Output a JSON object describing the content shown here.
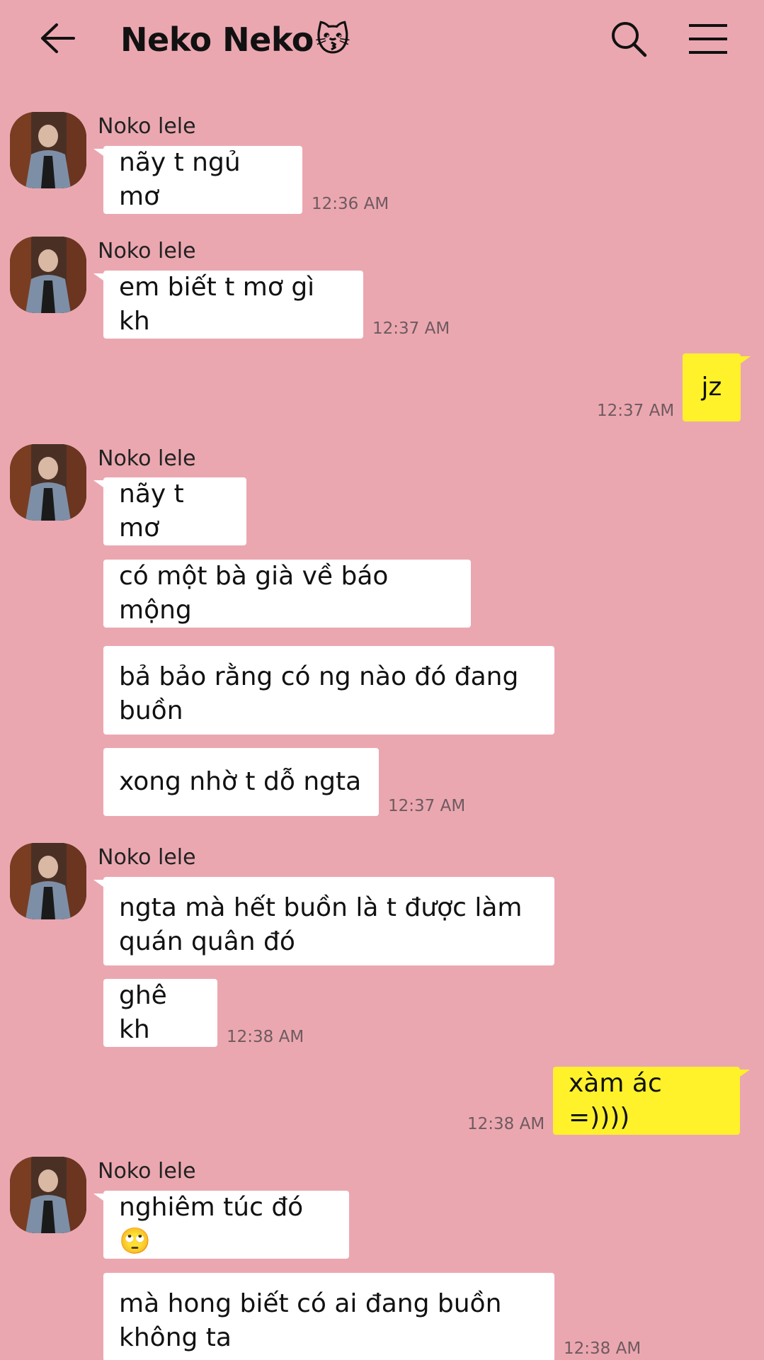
{
  "header": {
    "title": "Neko Neko",
    "title_emoji": "😽",
    "back_icon": "arrow-left-icon",
    "search_icon": "search-icon",
    "menu_icon": "hamburger-menu-icon"
  },
  "colors": {
    "background": "#eba7b0",
    "incoming_bubble": "#ffffff",
    "outgoing_bubble": "#fff22a"
  },
  "messages": [
    {
      "sender": "Noko lele",
      "text": "nãy t ngủ mơ",
      "time": "12:36 AM"
    },
    {
      "sender": "Noko lele",
      "text": "em biết t mơ gì kh",
      "time": "12:37 AM"
    },
    {
      "sender": "me",
      "text": "jz",
      "time": "12:37 AM"
    },
    {
      "sender": "Noko lele",
      "text": "nãy t mơ"
    },
    {
      "sender": "Noko lele",
      "text": "có một bà già về báo mộng"
    },
    {
      "sender": "Noko lele",
      "text": "bả bảo rằng có ng nào đó đang buồn"
    },
    {
      "sender": "Noko lele",
      "text": "xong nhờ t dỗ ngta",
      "time": "12:37 AM"
    },
    {
      "sender": "Noko lele",
      "text": "ngta mà hết buồn là t được làm quán quân đó"
    },
    {
      "sender": "Noko lele",
      "text": "ghê kh",
      "time": "12:38 AM"
    },
    {
      "sender": "me",
      "text": "xàm ác =))))",
      "time": "12:38 AM"
    },
    {
      "sender": "Noko lele",
      "text": "nghiêm túc đó🙄"
    },
    {
      "sender": "Noko lele",
      "text": "mà hong biết có ai đang buồn không ta",
      "time": "12:38 AM"
    }
  ],
  "senders": {
    "other": "Noko lele"
  }
}
